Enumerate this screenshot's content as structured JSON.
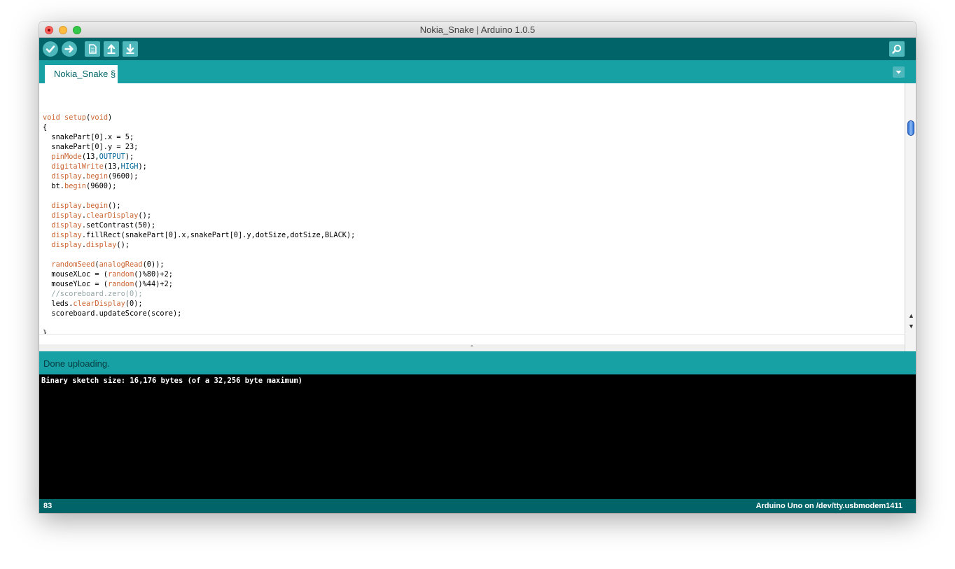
{
  "window": {
    "title": "Nokia_Snake | Arduino 1.0.5"
  },
  "toolbar": {
    "buttons": [
      {
        "name": "verify",
        "icon": "check-icon"
      },
      {
        "name": "upload",
        "icon": "arrow-right-icon"
      },
      {
        "name": "new",
        "icon": "document-icon"
      },
      {
        "name": "open",
        "icon": "arrow-up-icon"
      },
      {
        "name": "save",
        "icon": "arrow-down-icon"
      },
      {
        "name": "serial-monitor",
        "icon": "magnifier-icon"
      }
    ]
  },
  "tabs": {
    "active": "Nokia_Snake §"
  },
  "editor": {
    "code_lines": [
      "",
      "void setup(void)",
      "{",
      "  snakePart[0].x = 5;",
      "  snakePart[0].y = 23;",
      "  pinMode(13,OUTPUT);",
      "  digitalWrite(13,HIGH);",
      "  display.begin(9600);",
      "  bt.begin(9600);",
      "",
      "  display.begin();",
      "  display.clearDisplay();",
      "  display.setContrast(50);",
      "  display.fillRect(snakePart[0].x,snakePart[0].y,dotSize,dotSize,BLACK);",
      "  display.display();",
      "",
      "  randomSeed(analogRead(0));",
      "  mouseXLoc = (random()%80)+2;",
      "  mouseYLoc = (random()%44)+2;",
      "  //scoreboard.zero(0);",
      "  leds.clearDisplay(0);",
      "  scoreboard.updateScore(score);",
      "",
      "}"
    ]
  },
  "status": {
    "message": "Done uploading."
  },
  "console": {
    "output": "Binary sketch size: 16,176 bytes (of a 32,256 byte maximum)"
  },
  "footer": {
    "line_number": "83",
    "board": "Arduino Uno on /dev/tty.usbmodem1411"
  },
  "colors": {
    "toolbar": "#006468",
    "tabbar": "#17a1a5",
    "keyword": "#cc6633",
    "constant": "#006699",
    "comment": "#95a5a6"
  }
}
